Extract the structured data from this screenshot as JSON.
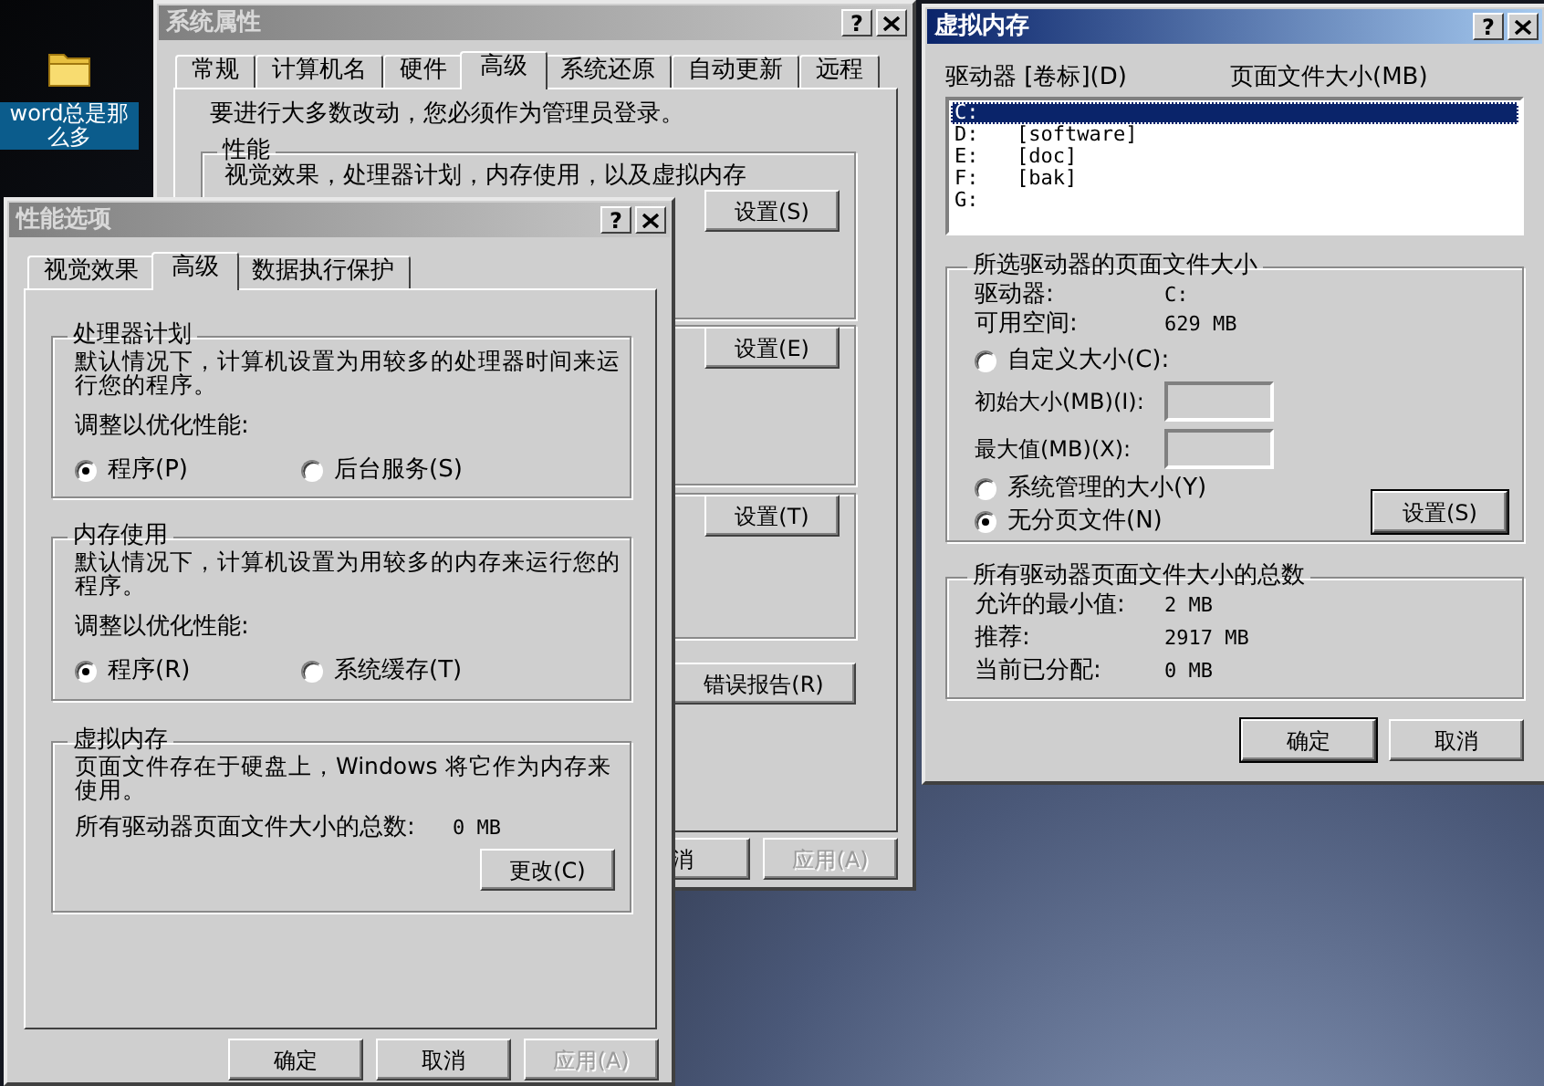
{
  "desktop_icon": {
    "label": "word总是那么多"
  },
  "system_properties": {
    "title": "系统属性",
    "active": false,
    "help": "?",
    "tabs": [
      {
        "label": "常规",
        "selected": false
      },
      {
        "label": "计算机名",
        "selected": false
      },
      {
        "label": "硬件",
        "selected": false
      },
      {
        "label": "高级",
        "selected": true
      },
      {
        "label": "系统还原",
        "selected": false
      },
      {
        "label": "自动更新",
        "selected": false
      },
      {
        "label": "远程",
        "selected": false
      }
    ],
    "notice": "要进行大多数改动，您必须作为管理员登录。",
    "groups": [
      {
        "label": "性能",
        "description": "视觉效果，处理器计划，内存使用，以及虚拟内存",
        "button": "设置(S)"
      },
      {
        "button": "设置(E)"
      },
      {
        "button": "设置(T)"
      }
    ],
    "error_report_button": "错误报告(R)",
    "buttons": [
      {
        "label": "消",
        "disabled": false
      },
      {
        "label": "应用(A)",
        "disabled": true
      }
    ]
  },
  "performance_options": {
    "title": "性能选项",
    "active": false,
    "help": "?",
    "tabs": [
      {
        "label": "视觉效果",
        "selected": false
      },
      {
        "label": "高级",
        "selected": true
      },
      {
        "label": "数据执行保护",
        "selected": false
      }
    ],
    "groups": [
      {
        "label": "处理器计划",
        "description": "默认情况下，计算机设置为用较多的处理器时间来运行您的程序。",
        "adjust_label": "调整以优化性能:",
        "radios": [
          {
            "label": "程序(P)",
            "selected": true
          },
          {
            "label": "后台服务(S)",
            "selected": false
          }
        ]
      },
      {
        "label": "内存使用",
        "description": "默认情况下，计算机设置为用较多的内存来运行您的程序。",
        "adjust_label": "调整以优化性能:",
        "radios": [
          {
            "label": "程序(R)",
            "selected": true
          },
          {
            "label": "系统缓存(T)",
            "selected": false
          }
        ]
      }
    ],
    "virtual_memory": {
      "label": "虚拟内存",
      "description": "页面文件存在于硬盘上，Windows 将它作为内存来使用。",
      "total_label": "所有驱动器页面文件大小的总数:",
      "total_value": "0 MB",
      "button": "更改(C)"
    },
    "buttons": [
      {
        "label": "确定",
        "disabled": false
      },
      {
        "label": "取消",
        "disabled": false
      },
      {
        "label": "应用(A)",
        "disabled": true
      }
    ]
  },
  "virtual_memory": {
    "title": "虚拟内存",
    "active": true,
    "help": "?",
    "columns": [
      "驱动器 [卷标](D)",
      "页面文件大小(MB)"
    ],
    "drives": [
      {
        "drive": "C:",
        "selected": true
      },
      {
        "drive": "D:",
        "volume": "[software]",
        "selected": false
      },
      {
        "drive": "E:",
        "volume": "[doc]",
        "selected": false
      },
      {
        "drive": "F:",
        "volume": "[bak]",
        "selected": false
      },
      {
        "drive": "G:",
        "selected": false
      }
    ],
    "selected_drive": {
      "label": "所选驱动器的页面文件大小",
      "info": [
        {
          "label": "驱动器:",
          "value": "C:"
        },
        {
          "label": "可用空间:",
          "value": "629 MB"
        }
      ],
      "options": [
        {
          "kind": "radio",
          "label": "自定义大小(C):",
          "selected": false
        },
        {
          "kind": "field",
          "label": "初始大小(MB)(I):",
          "disabled": true
        },
        {
          "kind": "field",
          "label": "最大值(MB)(X):",
          "disabled": true
        },
        {
          "kind": "radio",
          "label": "系统管理的大小(Y)",
          "selected": false
        },
        {
          "kind": "radio",
          "label": "无分页文件(N)",
          "selected": true
        }
      ],
      "button": "设置(S)"
    },
    "totals": {
      "label": "所有驱动器页面文件大小的总数",
      "rows": [
        {
          "label": "允许的最小值:",
          "value": "2 MB"
        },
        {
          "label": "推荐:",
          "value": "2917 MB"
        },
        {
          "label": "当前已分配:",
          "value": "0 MB"
        }
      ]
    },
    "buttons": [
      {
        "label": "确定",
        "default": true
      },
      {
        "label": "取消",
        "default": false
      }
    ]
  }
}
